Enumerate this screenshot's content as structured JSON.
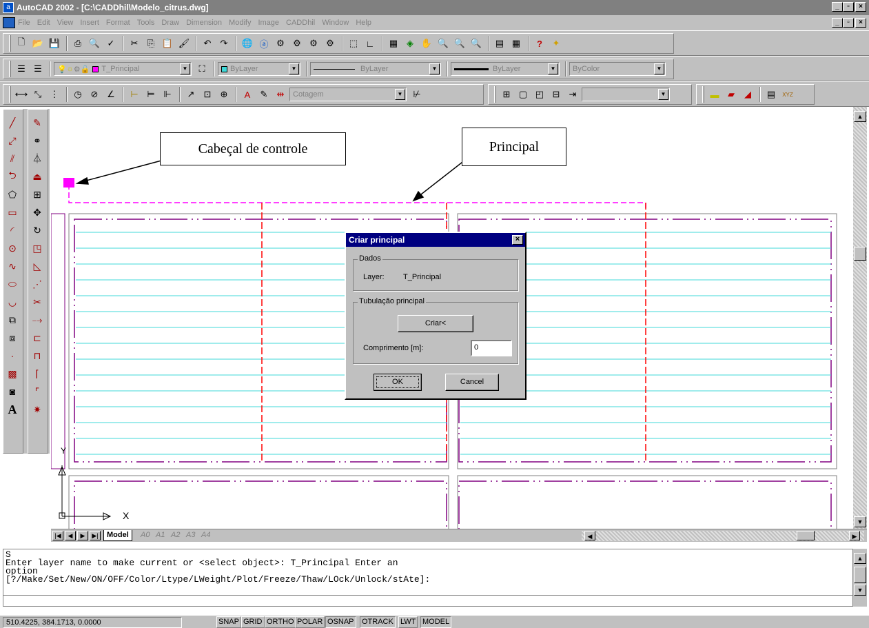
{
  "window": {
    "title": "AutoCAD 2002 - [C:\\CADDhil\\Modelo_citrus.dwg]"
  },
  "menu": [
    "File",
    "Edit",
    "View",
    "Insert",
    "Format",
    "Tools",
    "Draw",
    "Dimension",
    "Modify",
    "Image",
    "CADDhil",
    "Window",
    "Help"
  ],
  "layers_toolbar": {
    "layer_name": "T_Principal",
    "color": "ByLayer",
    "linetype": "ByLayer",
    "lineweight": "ByLayer",
    "plotstyle": "ByColor"
  },
  "dim_toolbar": {
    "dimstyle": "Cotagem"
  },
  "callouts": {
    "control_head": "Cabeçal de controle",
    "principal": "Principal"
  },
  "axis": {
    "x": "X",
    "y": "Y"
  },
  "tabs": [
    "Model",
    "A0",
    "A1",
    "A2",
    "A3",
    "A4"
  ],
  "dialog": {
    "title": "Criar principal",
    "group_dados": "Dados",
    "layer_label": "Layer:",
    "layer_value": "T_Principal",
    "group_tubulacao": "Tubulação principal",
    "criar_button": "Criar<",
    "comprimento_label": "Comprimento [m]:",
    "comprimento_value": "0",
    "ok_button": "OK",
    "cancel_button": "Cancel"
  },
  "command_window": {
    "lines": [
      "S",
      "Enter layer name to make current or <select object>: T_Principal Enter an",
      "option",
      "[?/Make/Set/New/ON/OFF/Color/Ltype/LWeight/Plot/Freeze/Thaw/LOck/Unlock/stAte]:"
    ]
  },
  "status": {
    "coords": "510.4225, 384.1713, 0.0000",
    "buttons": [
      "SNAP",
      "GRID",
      "ORTHO",
      "POLAR",
      "OSNAP",
      "OTRACK",
      "LWT",
      "MODEL"
    ]
  },
  "colors": {
    "title_inactive": "#808080",
    "dialog_title": "#000080",
    "cyan_lines": "#40d8d8",
    "purple_border": "#800080",
    "red_dash": "#ff0000",
    "magenta": "#ff00ff"
  }
}
